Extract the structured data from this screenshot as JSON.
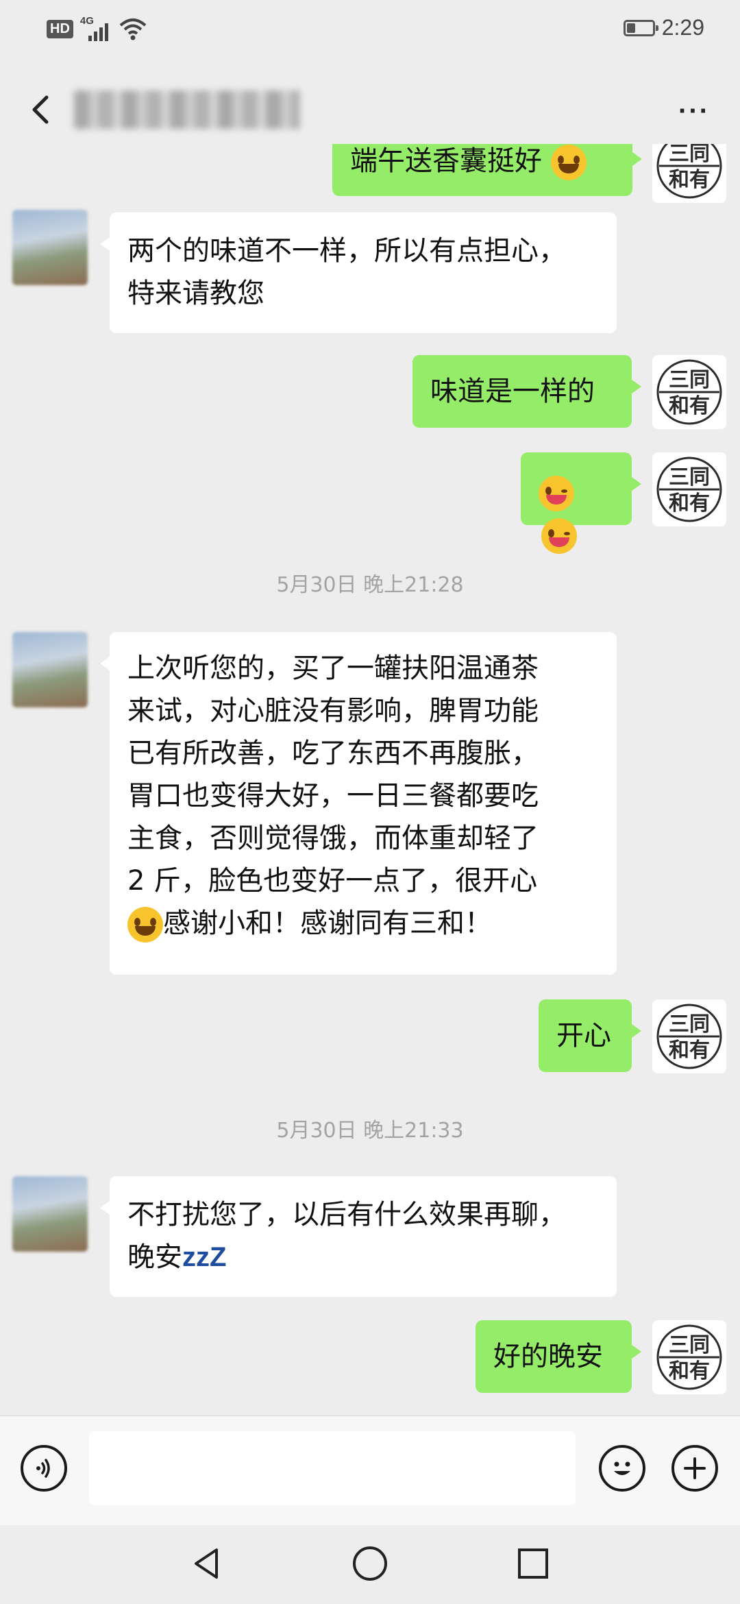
{
  "status_bar": {
    "network": "HD",
    "signal": "4G",
    "time": "2:29",
    "battery_level": 0.3
  },
  "header": {
    "back_icon": "chevron-left-icon",
    "title_blurred": true,
    "more_label": "···"
  },
  "messages": [
    {
      "side": "out",
      "text": "端午送香囊挺好",
      "partial": true
    },
    {
      "side": "in",
      "lines": [
        "两个的味道不一样，所以有点担心，",
        "特来请教您"
      ]
    },
    {
      "side": "out",
      "text": "味道是一样的"
    },
    {
      "side": "out",
      "emoji": [
        "tongue-wink-emoji",
        "tongue-wink-emoji"
      ]
    },
    {
      "type": "time",
      "text": "5月30日 晚上21:28"
    },
    {
      "side": "in",
      "lines": [
        "上次听您的，买了一罐扶阳温通茶",
        "来试，对心脏没有影响，脾胃功能",
        "已有所改善，吃了东西不再腹胀，",
        "胃口也变得大好，一日三餐都要吃",
        "主食，否则觉得饿，而体重却轻了",
        "2 斤，脸色也变好一点了，很开心",
        "感谢小和！感谢同有三和！"
      ]
    },
    {
      "side": "out",
      "text": "开心"
    },
    {
      "type": "time",
      "text": "5月30日 晚上21:33"
    },
    {
      "side": "in",
      "lines": [
        "不打扰您了，以后有什么效果再聊，",
        "晚安"
      ],
      "suffix": "zzZ"
    },
    {
      "side": "out",
      "text": "好的晚安"
    }
  ],
  "avatar_out_text": {
    "top": "三同",
    "bottom": "和有"
  },
  "input_bar": {
    "voice_icon": "voice-icon",
    "emoji_icon": "smiley-icon",
    "plus_icon": "plus-icon",
    "placeholder": ""
  },
  "system_nav": [
    "back-triangle-icon",
    "home-circle-icon",
    "recents-square-icon"
  ]
}
